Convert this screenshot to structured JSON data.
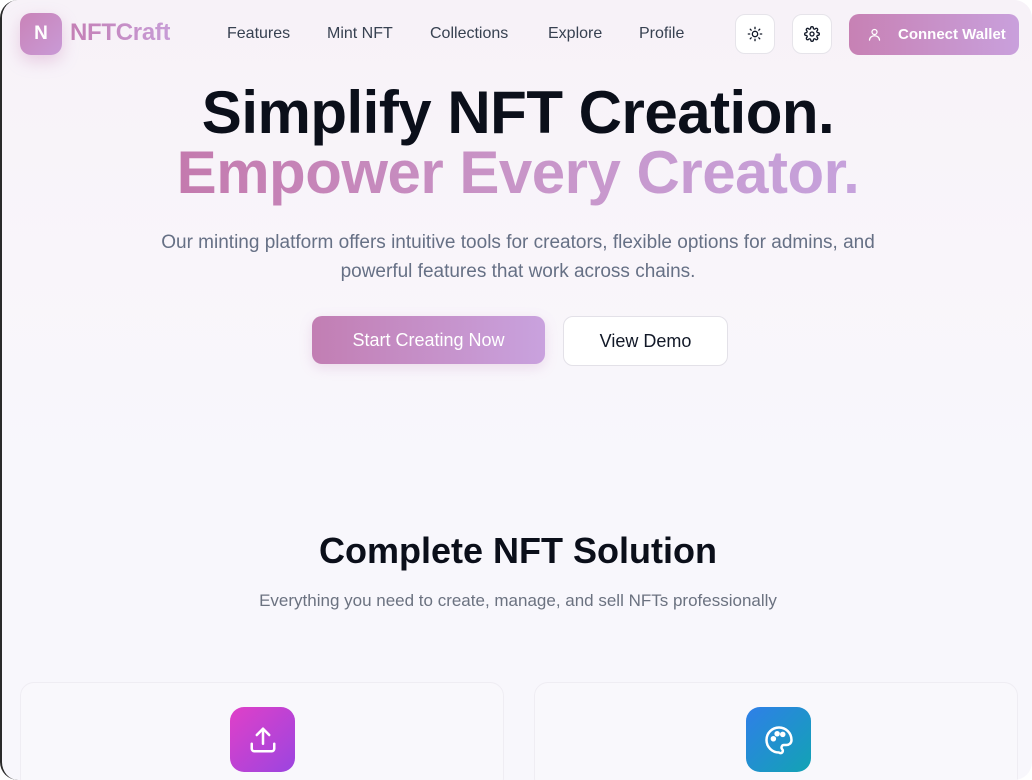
{
  "brand": {
    "logo_letter": "N",
    "name": "NFTCraft"
  },
  "nav": {
    "links": [
      "Features",
      "Mint NFT",
      "Collections",
      "Explore",
      "Profile"
    ],
    "theme_icon": "sun-icon",
    "settings_icon": "gear-icon",
    "connect_label": "Connect Wallet",
    "connect_icon": "user-icon"
  },
  "hero": {
    "title_line1": "Simplify NFT Creation.",
    "title_line2": "Empower Every Creator.",
    "lead_line1": "Our minting platform offers intuitive tools for creators, flexible options for admins, and",
    "lead_line2": "powerful features that work across chains.",
    "primary_cta": "Start Creating Now",
    "secondary_cta": "View Demo"
  },
  "features": {
    "title": "Complete NFT Solution",
    "subtitle": "Everything you need to create, manage, and sell NFTs professionally",
    "cards": [
      {
        "icon": "upload-icon",
        "color_from": "#e040c8",
        "color_to": "#9b45e0"
      },
      {
        "icon": "palette-icon",
        "color_from": "#2f7fe8",
        "color_to": "#12a3b4"
      }
    ]
  },
  "colors": {
    "accent_from": "#c47fb5",
    "accent_to": "#c99ad6",
    "heading": "#0b0f1a",
    "muted": "#667085"
  }
}
